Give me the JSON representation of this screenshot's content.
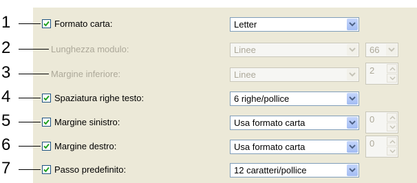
{
  "callouts": [
    "1",
    "2",
    "3",
    "4",
    "5",
    "6",
    "7"
  ],
  "rows": [
    {
      "label": "Formato carta:",
      "checked": true,
      "enabled": true,
      "combo": "Letter"
    },
    {
      "label": "Lunghezza modulo:",
      "enabled": false,
      "combo": "Linee",
      "small_value": "66"
    },
    {
      "label": "Margine inferiore:",
      "enabled": false,
      "combo": "Linee",
      "spin_value": "2"
    },
    {
      "label": "Spaziatura righe testo:",
      "checked": true,
      "enabled": true,
      "combo": "6 righe/pollice"
    },
    {
      "label": "Margine sinistro:",
      "checked": true,
      "enabled": true,
      "combo": "Usa formato carta",
      "spin_value": "0"
    },
    {
      "label": "Margine destro:",
      "checked": true,
      "enabled": true,
      "combo": "Usa formato carta",
      "spin_value": "0"
    },
    {
      "label": "Passo predefinito:",
      "checked": true,
      "enabled": true,
      "combo": "12 caratteri/pollice"
    }
  ],
  "icons": {
    "checkbox": "checkmark-icon",
    "dropdown": "chevron-down-icon",
    "spin_up": "chevron-up-icon",
    "spin_down": "chevron-down-icon"
  },
  "colors": {
    "panel": "#ece9d8",
    "disabled_text": "#aca899",
    "check": "#21a121",
    "combo_border": "#7f9db9"
  }
}
